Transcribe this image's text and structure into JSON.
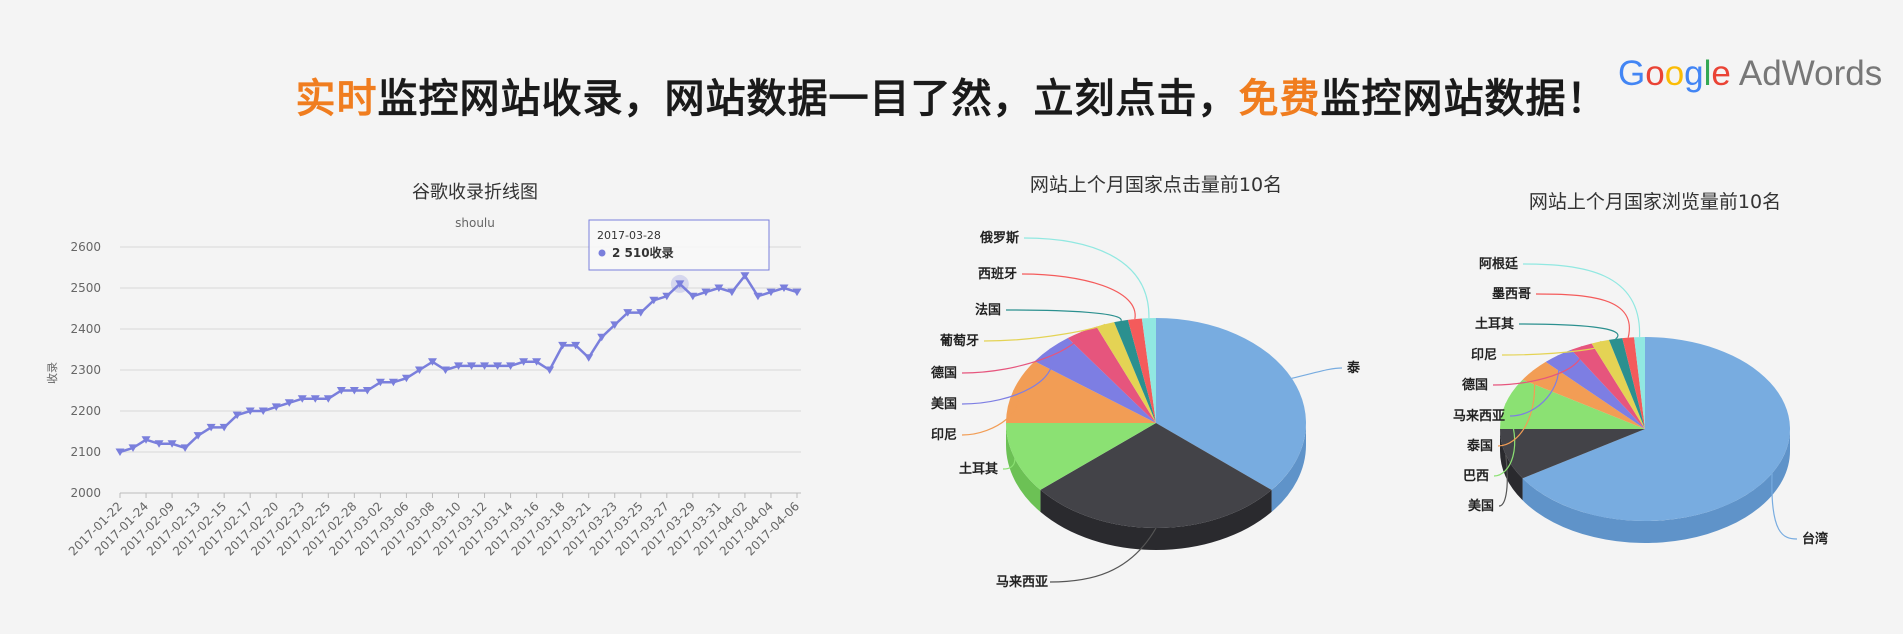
{
  "banner": {
    "hl1": "实时",
    "part1": "监控网站收录，网站数据一目了然，立刻点击，",
    "hl2": "免费",
    "part2": "监控网站数据！",
    "logo_g1": "G",
    "logo_g2": "o",
    "logo_g3": "o",
    "logo_g4": "g",
    "logo_g5": "l",
    "logo_g6": "e",
    "logo_product": "AdWords"
  },
  "chart_data": [
    {
      "type": "line",
      "title": "谷歌收录折线图",
      "subtitle": "shoulu",
      "ylabel": "收录",
      "ylim": [
        2000,
        2600
      ],
      "yticks": [
        2000,
        2100,
        2200,
        2300,
        2400,
        2500,
        2600
      ],
      "grid": true,
      "color": "#7a7fdc",
      "x": [
        "2017-01-22",
        "2017-01-23",
        "2017-01-24",
        "2017-01-25",
        "2017-02-09",
        "2017-02-10",
        "2017-02-13",
        "2017-02-14",
        "2017-02-15",
        "2017-02-16",
        "2017-02-17",
        "2017-02-18",
        "2017-02-20",
        "2017-02-21",
        "2017-02-23",
        "2017-02-24",
        "2017-02-25",
        "2017-02-27",
        "2017-02-28",
        "2017-03-01",
        "2017-03-02",
        "2017-03-03",
        "2017-03-06",
        "2017-03-07",
        "2017-03-08",
        "2017-03-09",
        "2017-03-10",
        "2017-03-11",
        "2017-03-12",
        "2017-03-13",
        "2017-03-14",
        "2017-03-15",
        "2017-03-16",
        "2017-03-17",
        "2017-03-18",
        "2017-03-20",
        "2017-03-21",
        "2017-03-22",
        "2017-03-23",
        "2017-03-24",
        "2017-03-25",
        "2017-03-26",
        "2017-03-27",
        "2017-03-28",
        "2017-03-29",
        "2017-03-30",
        "2017-03-31",
        "2017-04-01",
        "2017-04-02",
        "2017-04-03",
        "2017-04-04",
        "2017-04-05",
        "2017-04-06"
      ],
      "xtick_labels": [
        "2017-01-22",
        "2017-01-24",
        "2017-02-09",
        "2017-02-13",
        "2017-02-15",
        "2017-02-17",
        "2017-02-20",
        "2017-02-23",
        "2017-02-25",
        "2017-02-28",
        "2017-03-02",
        "2017-03-06",
        "2017-03-08",
        "2017-03-10",
        "2017-03-12",
        "2017-03-14",
        "2017-03-16",
        "2017-03-18",
        "2017-03-21",
        "2017-03-23",
        "2017-03-25",
        "2017-03-27",
        "2017-03-29",
        "2017-03-31",
        "2017-04-02",
        "2017-04-04",
        "2017-04-06"
      ],
      "values": [
        2100,
        2110,
        2130,
        2120,
        2120,
        2110,
        2140,
        2160,
        2160,
        2190,
        2200,
        2200,
        2210,
        2220,
        2230,
        2230,
        2230,
        2250,
        2250,
        2250,
        2270,
        2270,
        2280,
        2300,
        2320,
        2300,
        2310,
        2310,
        2310,
        2310,
        2310,
        2320,
        2320,
        2300,
        2360,
        2360,
        2330,
        2380,
        2410,
        2440,
        2440,
        2470,
        2480,
        2510,
        2480,
        2490,
        2500,
        2490,
        2530,
        2480,
        2490,
        2500,
        2490
      ],
      "tooltip": {
        "date": "2017-03-28",
        "value": "2 510收录"
      }
    },
    {
      "type": "pie",
      "title": "网站上个月国家点击量前10名",
      "slices": [
        {
          "label": "泰国",
          "value": 36.0,
          "color": "#78ace0",
          "side": "#5f93c9"
        },
        {
          "label": "马来西亚",
          "value": 28.0,
          "color": "#434348",
          "side": "#2a2a2e"
        },
        {
          "label": "土耳其",
          "value": 11.0,
          "color": "#8be173",
          "side": "#6cc155"
        },
        {
          "label": "印尼",
          "value": 10.0,
          "color": "#f29d55",
          "side": "#d47e37"
        },
        {
          "label": "美国",
          "value": 5.0,
          "color": "#7d7ee3",
          "side": "#6061c4"
        },
        {
          "label": "德国",
          "value": 3.5,
          "color": "#e6557d",
          "side": "#c73860"
        },
        {
          "label": "葡萄牙",
          "value": 2.0,
          "color": "#e4d354",
          "side": "#c5b436"
        },
        {
          "label": "法国",
          "value": 1.5,
          "color": "#2b908f",
          "side": "#127271"
        },
        {
          "label": "西班牙",
          "value": 1.5,
          "color": "#f45b5b",
          "side": "#d53c3c"
        },
        {
          "label": "俄罗斯",
          "value": 1.5,
          "color": "#91e8e1",
          "side": "#72c9c2"
        }
      ]
    },
    {
      "type": "pie",
      "title": "网站上个月国家浏览量前10名",
      "slices": [
        {
          "label": "台湾",
          "value": 66.0,
          "color": "#78ace0",
          "side": "#5f93c9"
        },
        {
          "label": "美国",
          "value": 9.0,
          "color": "#434348",
          "side": "#2a2a2e"
        },
        {
          "label": "巴西",
          "value": 9.0,
          "color": "#8be173",
          "side": "#6cc155"
        },
        {
          "label": "泰国",
          "value": 4.0,
          "color": "#f29d55",
          "side": "#d47e37"
        },
        {
          "label": "马来西亚",
          "value": 3.5,
          "color": "#7d7ee3",
          "side": "#6061c4"
        },
        {
          "label": "德国",
          "value": 2.5,
          "color": "#e6557d",
          "side": "#c73860"
        },
        {
          "label": "印尼",
          "value": 2.0,
          "color": "#e4d354",
          "side": "#c5b436"
        },
        {
          "label": "土耳其",
          "value": 1.5,
          "color": "#2b908f",
          "side": "#127271"
        },
        {
          "label": "墨西哥",
          "value": 1.3,
          "color": "#f45b5b",
          "side": "#d53c3c"
        },
        {
          "label": "阿根廷",
          "value": 1.2,
          "color": "#91e8e1",
          "side": "#72c9c2"
        }
      ]
    }
  ]
}
